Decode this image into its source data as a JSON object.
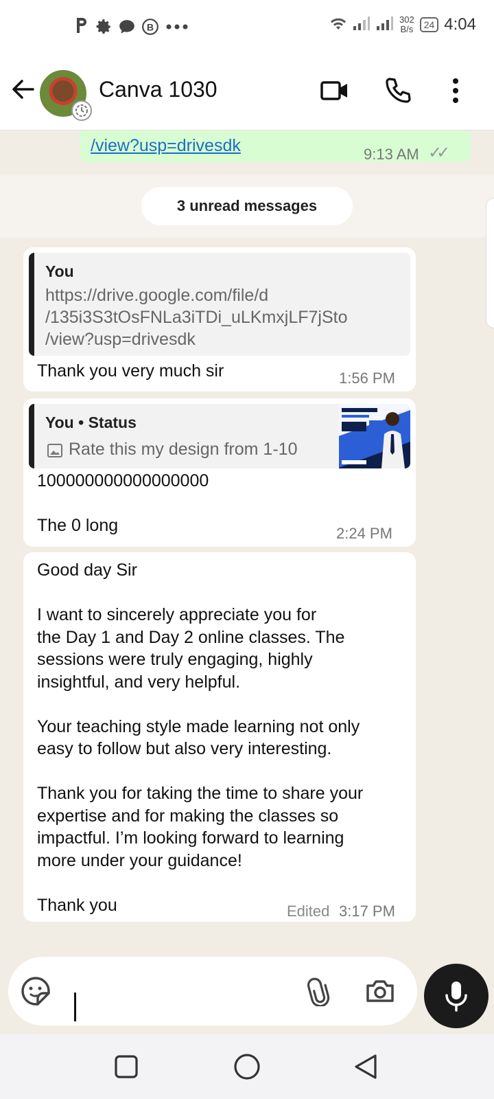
{
  "status_bar": {
    "left_icons": [
      "parking-icon",
      "gear-icon",
      "chat-bubble-icon",
      "b-circle-icon",
      "more-dots-icon"
    ],
    "net_speed_value": "302",
    "net_speed_unit": "B/s",
    "battery": "24",
    "time": "4:04"
  },
  "header": {
    "contact_name": "Canva 1030",
    "actions": [
      "video-call-icon",
      "phone-icon",
      "more-vert-icon"
    ]
  },
  "messages": {
    "previous_out": {
      "link_partial": "/view?usp=drivesdk",
      "time": "9:13 AM",
      "ticks": "✓✓"
    },
    "unread_label": "3 unread messages",
    "msg1": {
      "quote_author": "You",
      "quote_text": "https://drive.google.com/file/d\n/135i3S3tOsFNLa3iTDi_uLKmxjLF7jSto\n/view?usp=drivesdk",
      "text": "Thank you very much sir",
      "time": "1:56 PM"
    },
    "msg2": {
      "quote_author": "You • Status",
      "quote_text": "Rate this my design from 1-10",
      "text": "100000000000000000\n\nThe 0 long",
      "time": "2:24 PM"
    },
    "msg3": {
      "text": "Good day Sir\n\nI want to sincerely appreciate you for\nthe Day 1 and Day 2 online classes. The\nsessions were truly engaging, highly\ninsightful, and very helpful.\n\nYour teaching style made learning not only\neasy to follow but also very interesting.\n\nThank you for taking the time to share your\nexpertise and for making the classes so\nimpactful. I’m looking forward to learning\nmore under your guidance!\n\nThank you",
      "edited_label": "Edited",
      "time": "3:17 PM"
    }
  },
  "input": {
    "value": "",
    "icons": [
      "sticker-icon",
      "attach-icon",
      "camera-icon",
      "mic-icon"
    ]
  },
  "colors": {
    "outgoing_bubble": "#d9fdd3",
    "incoming_bubble": "#ffffff",
    "chat_background": "#f1ece4",
    "link": "#1a6fc4",
    "mic_button": "#1b1b1b"
  }
}
